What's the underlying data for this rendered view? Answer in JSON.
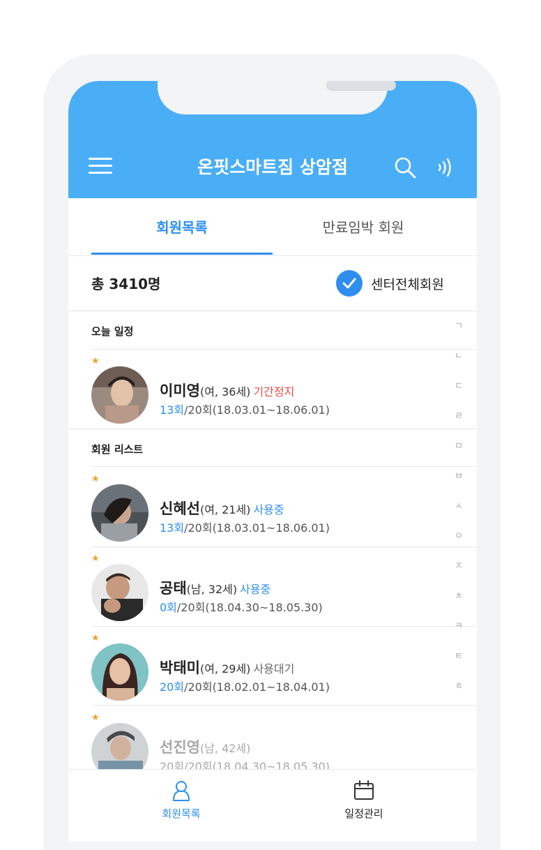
{
  "app": {
    "title": "온핏스마트짐 상암점"
  },
  "tabs": [
    {
      "label": "회원목록",
      "active": true
    },
    {
      "label": "만료임박 회원",
      "active": false
    }
  ],
  "summary": {
    "total": "총 3410명",
    "filter_label": "센터전체회원",
    "filter_checked": true
  },
  "sections": {
    "today": "오늘 일정",
    "members": "회원 리스트"
  },
  "today_members": [
    {
      "name": "이미영",
      "meta": "(여, 36세)",
      "status": "기간정지",
      "status_color": "#f04848",
      "used": "13회",
      "info": "/20회(18.03.01~18.06.01)"
    }
  ],
  "members": [
    {
      "name": "신혜선",
      "meta": "(여, 21세)",
      "status": "사용중",
      "status_color": "#2d8ef0",
      "used": "13회",
      "info": "/20회(18.03.01~18.06.01)"
    },
    {
      "name": "공태",
      "meta": "(남, 32세)",
      "status": "사용중",
      "status_color": "#2d8ef0",
      "used": "0회",
      "info": "/20회(18.04.30~18.05.30)"
    },
    {
      "name": "박태미",
      "meta": "(여, 29세)",
      "status": "사용대기",
      "status_color": "#666666",
      "used": "20회",
      "info": "/20회(18.02.01~18.04.01)"
    },
    {
      "name": "선진영",
      "meta": "(남, 42세)",
      "status": "",
      "status_color": "#a8a8a8",
      "used": "20회",
      "info": "/20회(18.04.30~18.05.30)"
    }
  ],
  "index_letters": [
    "ㄱ",
    "ㄴ",
    "ㄷ",
    "ㄹ",
    "ㅁ",
    "ㅂ",
    "ㅅ",
    "ㅇ",
    "ㅈ",
    "ㅊ",
    "ㅋ",
    "ㅌ",
    "ㅎ"
  ],
  "bottom_nav": [
    {
      "label": "회원목록",
      "icon": "user-icon",
      "active": true
    },
    {
      "label": "일정관리",
      "icon": "calendar-icon",
      "active": false
    }
  ],
  "colors": {
    "header": "#4aaef7",
    "accent": "#2d8ef0",
    "star": "#f5a020",
    "warning": "#f04848"
  }
}
